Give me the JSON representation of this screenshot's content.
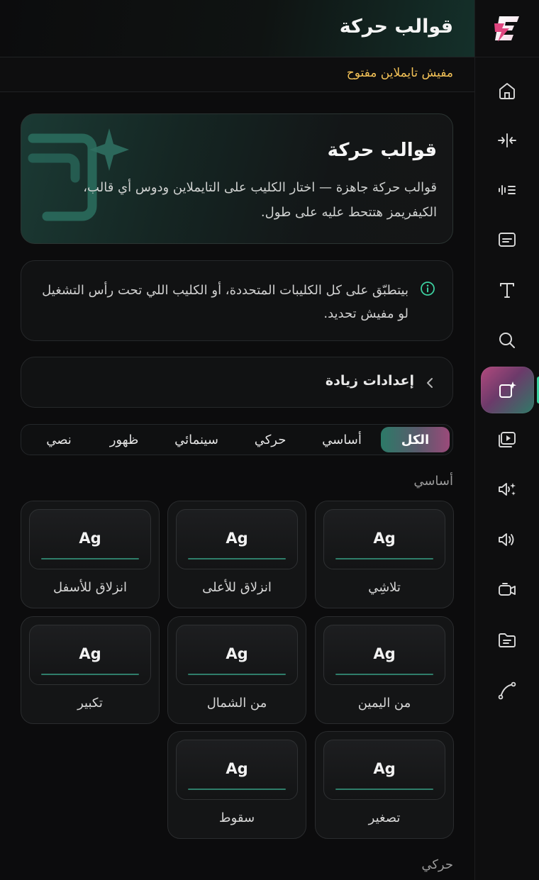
{
  "header": {
    "title": "قوالب حركة"
  },
  "timeline_status": "مفيش تايملاين مفتوح",
  "hero": {
    "title": "قوالب حركة",
    "description": "قوالب حركة جاهزة — اختار الكليب على التايملاين ودوس أي قالب، الكيفريمز هتتحط عليه على طول."
  },
  "info": {
    "text": "بيتطبّق على كل الكليبات المتحددة، أو الكليب اللي تحت رأس التشغيل لو مفيش تحديد."
  },
  "advanced": {
    "label": "إعدادات زيادة"
  },
  "tabs": [
    {
      "label": "الكل",
      "active": true
    },
    {
      "label": "أساسي",
      "active": false
    },
    {
      "label": "حركي",
      "active": false
    },
    {
      "label": "سينمائي",
      "active": false
    },
    {
      "label": "ظهور",
      "active": false
    },
    {
      "label": "نصي",
      "active": false
    }
  ],
  "sections": [
    {
      "title": "أساسي",
      "items": [
        {
          "preview": "Ag",
          "label": "تلاشِي"
        },
        {
          "preview": "Ag",
          "label": "انزلاق للأعلى"
        },
        {
          "preview": "Ag",
          "label": "انزلاق للأسفل"
        },
        {
          "preview": "Ag",
          "label": "من اليمين"
        },
        {
          "preview": "Ag",
          "label": "من الشمال"
        },
        {
          "preview": "Ag",
          "label": "تكبير"
        },
        {
          "preview": "Ag",
          "label": "تصغير"
        },
        {
          "preview": "Ag",
          "label": "سقوط"
        }
      ]
    },
    {
      "title": "حركي",
      "items": []
    }
  ],
  "rail": {
    "logo": "E",
    "items": [
      {
        "icon": "home-icon"
      },
      {
        "icon": "split-icon"
      },
      {
        "icon": "audio-waveform-icon"
      },
      {
        "icon": "subtitles-icon"
      },
      {
        "icon": "text-icon"
      },
      {
        "icon": "search-icon"
      },
      {
        "icon": "motion-templates-icon",
        "active": true
      },
      {
        "icon": "media-library-icon"
      },
      {
        "icon": "ai-voice-icon"
      },
      {
        "icon": "volume-icon"
      },
      {
        "icon": "record-camera-icon"
      },
      {
        "icon": "folder-icon"
      },
      {
        "icon": "curve-icon"
      }
    ]
  },
  "colors": {
    "accent_green": "#3ccf9f",
    "accent_pink": "#b24a7e",
    "warning_text": "#f3c257",
    "background": "#0c0c0d"
  }
}
